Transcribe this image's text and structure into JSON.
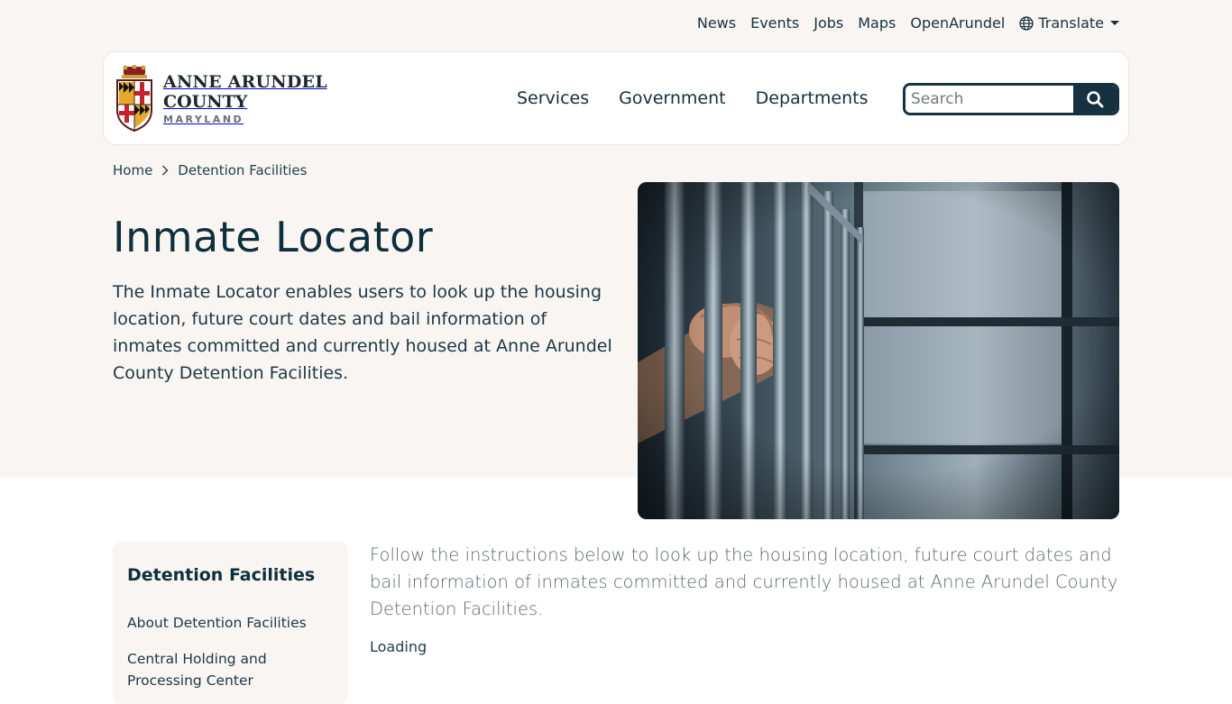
{
  "utility_nav": {
    "items": [
      "News",
      "Events",
      "Jobs",
      "Maps",
      "OpenArundel"
    ],
    "translate_label": "Translate"
  },
  "header": {
    "logo": {
      "line1": "ANNE ARUNDEL",
      "line2": "COUNTY",
      "line3": "MARYLAND"
    },
    "main_nav": [
      "Services",
      "Government",
      "Departments"
    ],
    "search": {
      "placeholder": "Search"
    }
  },
  "breadcrumb": {
    "home": "Home",
    "current": "Detention Facilities"
  },
  "page": {
    "title": "Inmate Locator",
    "intro": "The Inmate Locator enables users to look up the housing location, future court dates and bail information of inmates committed and currently housed at Anne Arundel County Detention Facilities."
  },
  "sidebar": {
    "title": "Detention Facilities",
    "links": [
      "About Detention Facilities",
      "Central Holding and Processing Center"
    ]
  },
  "content": {
    "instructions": "Follow the instructions below to look up the housing location, future court dates and bail information of inmates committed and currently housed at Anne Arundel County Detention Facilities.",
    "status": "Loading"
  },
  "colors": {
    "primary": "#163241",
    "hero_bg": "#f8f5f2",
    "body_text": "#1e3744"
  },
  "icons": {
    "translate": "globe-icon",
    "search": "search-icon",
    "breadcrumb_separator": "chevron-right-icon"
  }
}
